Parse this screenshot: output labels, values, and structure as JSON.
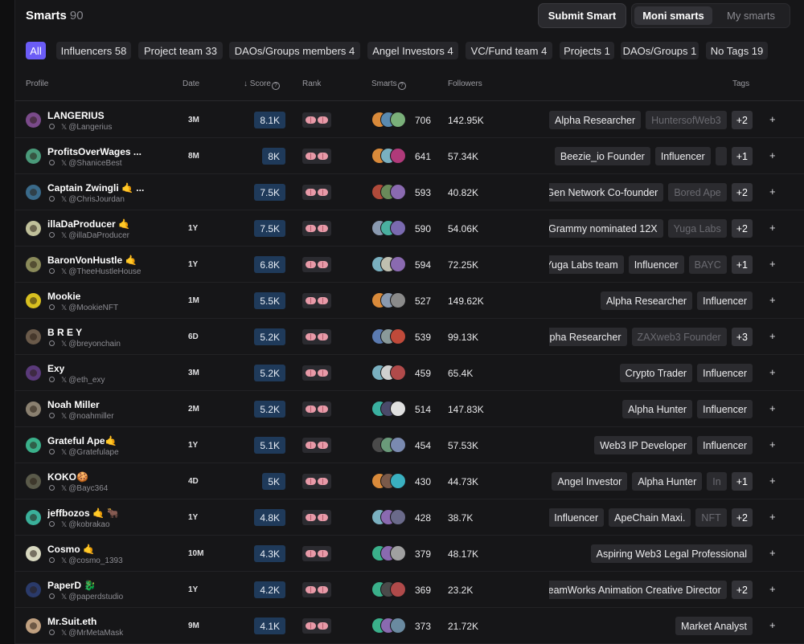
{
  "header": {
    "title": "Smarts",
    "count": "90",
    "submit_label": "Submit Smart",
    "segment": {
      "active": "Moni smarts",
      "inactive": "My smarts"
    }
  },
  "filters": [
    {
      "label": "All",
      "active": true
    },
    {
      "label": "Influencers 58"
    },
    {
      "label": "Project team 33"
    },
    {
      "label": "DAOs/Groups members 4"
    },
    {
      "label": "Angel Investors 4"
    },
    {
      "label": "VC/Fund team 4"
    },
    {
      "label": "Projects 1"
    },
    {
      "label": "DAOs/Groups 1"
    },
    {
      "label": "No Tags 19"
    }
  ],
  "columns": {
    "profile": "Profile",
    "date": "Date",
    "score": "↓ Score",
    "rank": "Rank",
    "smarts": "Smarts",
    "followers": "Followers",
    "tags": "Tags"
  },
  "rows": [
    {
      "name": "LANGERIUS",
      "handle": "@Langerius",
      "date": "3M",
      "score": "8.1K",
      "smarts": "706",
      "followers": "142.95K",
      "tags": [
        "Alpha Researcher",
        "HuntersofWeb3"
      ],
      "more": "+2",
      "avatar": "#7a4a8a",
      "stack": [
        "#d98a3a",
        "#5a8ab0",
        "#7ab07a"
      ]
    },
    {
      "name": "ProfitsOverWages ...",
      "handle": "@ShaniceBest",
      "date": "8M",
      "score": "8K",
      "smarts": "641",
      "followers": "57.34K",
      "tags": [
        "Beezie_io Founder",
        "Influencer",
        ""
      ],
      "more": "+1",
      "avatar": "#4a9a7a",
      "stack": [
        "#d98a3a",
        "#7ab0c0",
        "#b03a7a"
      ]
    },
    {
      "name": "Captain Zwingli 🤙 ...",
      "handle": "@ChrisJourdan",
      "date": "",
      "score": "7.5K",
      "smarts": "593",
      "followers": "40.82K",
      "tags": [
        "dGen Network Co-founder",
        "Bored Ape"
      ],
      "more": "+2",
      "avatar": "#3a6a8a",
      "stack": [
        "#b04a3a",
        "#6a8a5a",
        "#8a6ab0"
      ]
    },
    {
      "name": "illaDaProducer 🤙",
      "handle": "@illaDaProducer",
      "date": "1Y",
      "score": "7.5K",
      "smarts": "590",
      "followers": "54.06K",
      "tags": [
        "Grammy nominated 12X",
        "Yuga Labs"
      ],
      "more": "+2",
      "avatar": "#c0c09a",
      "stack": [
        "#8a9ab0",
        "#4ab0a0",
        "#7a6ab0"
      ]
    },
    {
      "name": "BaronVonHustle 🤙",
      "handle": "@TheeHustleHouse",
      "date": "1Y",
      "score": "6.8K",
      "smarts": "594",
      "followers": "72.25K",
      "tags": [
        "Yuga Labs team",
        "Influencer",
        "BAYC"
      ],
      "more": "+1",
      "avatar": "#8a8a5a",
      "stack": [
        "#7ab0c0",
        "#c0c0b0",
        "#8a6ab0"
      ]
    },
    {
      "name": "Mookie",
      "handle": "@MookieNFT",
      "date": "1M",
      "score": "5.5K",
      "smarts": "527",
      "followers": "149.62K",
      "tags": [
        "Alpha Researcher",
        "Influencer"
      ],
      "more": "",
      "avatar": "#d8c020",
      "stack": [
        "#d98a3a",
        "#8a9ab0",
        "#8a8a8a"
      ]
    },
    {
      "name": "B R E Y",
      "handle": "@breyonchain",
      "date": "6D",
      "score": "5.2K",
      "smarts": "539",
      "followers": "99.13K",
      "tags": [
        "Alpha Researcher",
        "ZAXweb3 Founder"
      ],
      "more": "+3",
      "avatar": "#6a5a4a",
      "stack": [
        "#5a7ab0",
        "#8a9a9a",
        "#c04a3a"
      ]
    },
    {
      "name": "Exy",
      "handle": "@eth_exy",
      "date": "3M",
      "score": "5.2K",
      "smarts": "459",
      "followers": "65.4K",
      "tags": [
        "Crypto Trader",
        "Influencer"
      ],
      "more": "",
      "avatar": "#5a3a7a",
      "stack": [
        "#7ab0c0",
        "#d0d0d0",
        "#b04a4a"
      ]
    },
    {
      "name": "Noah Miller",
      "handle": "@noahmiller",
      "date": "2M",
      "score": "5.2K",
      "smarts": "514",
      "followers": "147.83K",
      "tags": [
        "Alpha Hunter",
        "Influencer"
      ],
      "more": "",
      "avatar": "#8a8070",
      "stack": [
        "#3ab0a0",
        "#4a4a6a",
        "#e0e0e0"
      ]
    },
    {
      "name": "Grateful Ape🤙",
      "handle": "@Gratefulape",
      "date": "1Y",
      "score": "5.1K",
      "smarts": "454",
      "followers": "57.53K",
      "tags": [
        "Web3 IP Developer",
        "Influencer"
      ],
      "more": "",
      "avatar": "#3ab08a",
      "stack": [
        "#4a4a4a",
        "#6a9a7a",
        "#7a8ab0"
      ]
    },
    {
      "name": "KOKO🍪",
      "handle": "@Bayc364",
      "date": "4D",
      "score": "5K",
      "smarts": "430",
      "followers": "44.73K",
      "tags": [
        "Angel Investor",
        "Alpha Hunter",
        "In"
      ],
      "more": "+1",
      "avatar": "#5a5a4a",
      "stack": [
        "#d98a3a",
        "#7a5a4a",
        "#3ab0c0"
      ]
    },
    {
      "name": "jeffbozos 🤙 🐂",
      "handle": "@kobrakao",
      "date": "1Y",
      "score": "4.8K",
      "smarts": "428",
      "followers": "38.7K",
      "tags": [
        "Influencer",
        "ApeChain Maxi.",
        "NFT"
      ],
      "more": "+2",
      "avatar": "#3ab09a",
      "stack": [
        "#7ab0c0",
        "#8a6ab0",
        "#6a6a8a"
      ]
    },
    {
      "name": "Cosmo 🤙",
      "handle": "@cosmo_1393",
      "date": "10M",
      "score": "4.3K",
      "smarts": "379",
      "followers": "48.17K",
      "tags": [
        "Aspiring Web3 Legal Professional"
      ],
      "more": "",
      "avatar": "#d8d8c0",
      "stack": [
        "#3ab08a",
        "#8a6ab0",
        "#a0a0a0"
      ]
    },
    {
      "name": "PaperD 🐉",
      "handle": "@paperdstudio",
      "date": "1Y",
      "score": "4.2K",
      "smarts": "369",
      "followers": "23.2K",
      "tags": [
        "DreamWorks Animation Creative Director"
      ],
      "more": "+2",
      "avatar": "#2a3a6a",
      "stack": [
        "#3ab08a",
        "#4a4a4a",
        "#b04a4a"
      ]
    },
    {
      "name": "Mr.Suit.eth",
      "handle": "@MrMetaMask",
      "date": "9M",
      "score": "4.1K",
      "smarts": "373",
      "followers": "21.72K",
      "tags": [
        "Market Analyst"
      ],
      "more": "",
      "avatar": "#c0a080",
      "stack": [
        "#3ab08a",
        "#8a6ab0",
        "#6a8aa0"
      ]
    }
  ]
}
